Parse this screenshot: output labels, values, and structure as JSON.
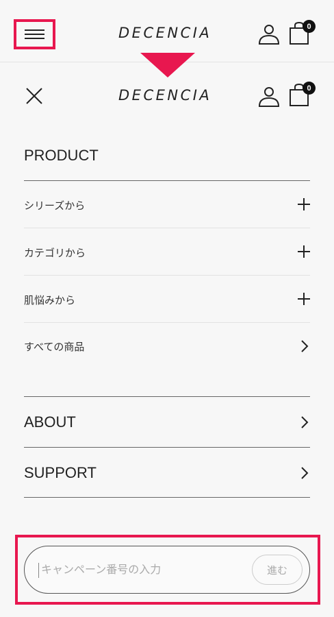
{
  "header": {
    "logo": "DECENCIA",
    "cart_count": "0"
  },
  "menu": {
    "logo": "DECENCIA",
    "cart_count": "0",
    "product": {
      "title": "PRODUCT",
      "items": [
        {
          "label": "シリーズから",
          "icon": "plus-icon"
        },
        {
          "label": "カテゴリから",
          "icon": "plus-icon"
        },
        {
          "label": "肌悩みから",
          "icon": "plus-icon"
        },
        {
          "label": "すべての商品",
          "icon": "chevron-right-icon"
        }
      ]
    },
    "about": {
      "title": "ABOUT",
      "icon": "chevron-right-icon"
    },
    "support": {
      "title": "SUPPORT",
      "icon": "chevron-right-icon"
    }
  },
  "campaign": {
    "placeholder": "キャンペーン番号の入力",
    "submit_label": "進む"
  },
  "colors": {
    "highlight": "#e8174f",
    "background": "#f7f7f7",
    "text": "#222222"
  }
}
